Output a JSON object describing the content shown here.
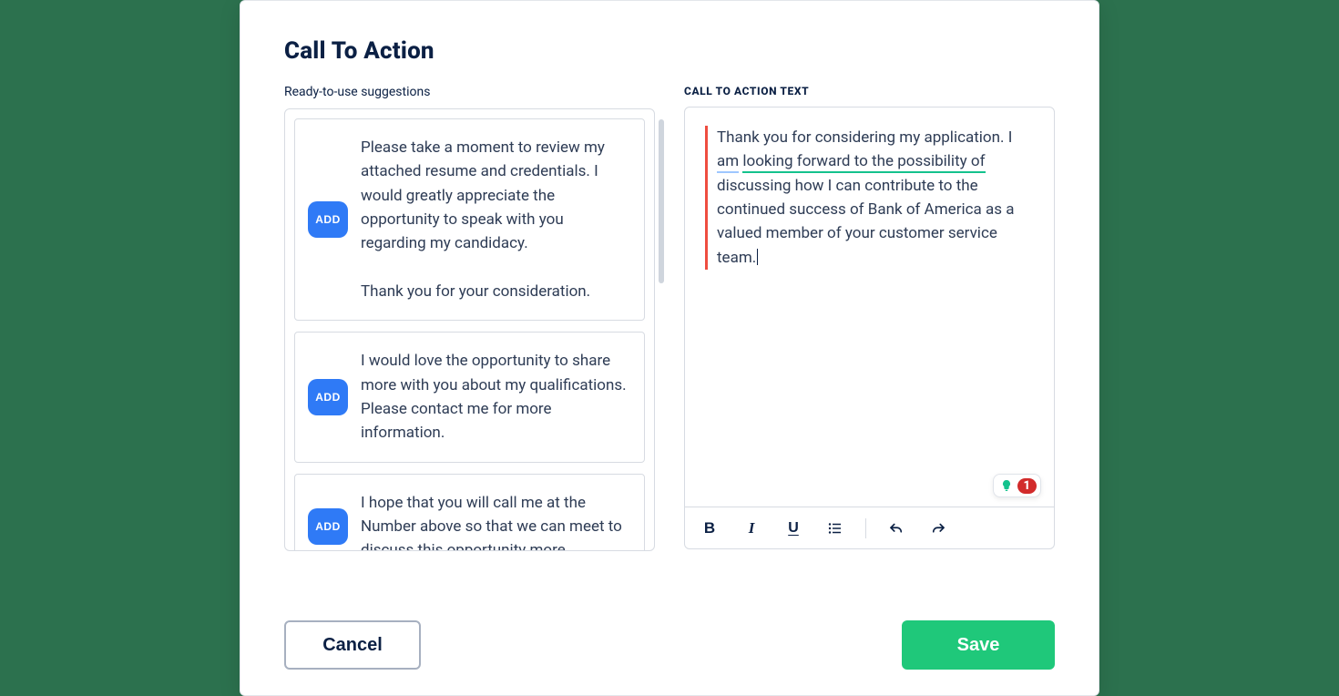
{
  "title": "Call To Action",
  "left": {
    "label": "Ready-to-use suggestions",
    "add_label": "ADD",
    "suggestions": [
      "Please take a moment to review my attached resume and credentials. I would greatly appreciate the opportunity to speak with you regarding my candidacy.\n\nThank you for your consideration.",
      "I would love the opportunity to share more with you about my qualifications. Please contact me for more information.",
      "I hope that you will call me at the Number above so that we can meet to discuss this opportunity more."
    ]
  },
  "right": {
    "label": "CALL TO ACTION TEXT",
    "text_plain": "Thank you for considering my application. I am looking forward to the possibility of discussing how I can contribute to the continued success of Bank of America as a valued member of your customer service team.",
    "segments": {
      "pre": "Thank you for considering my application. I ",
      "u1a": "am",
      "mid1": " ",
      "u2": "looking forward to the possibility of",
      "post": " discussing how I can contribute to the continued success of Bank of America as a valued member of your customer service team."
    },
    "error_count": "1"
  },
  "footer": {
    "cancel": "Cancel",
    "save": "Save"
  }
}
